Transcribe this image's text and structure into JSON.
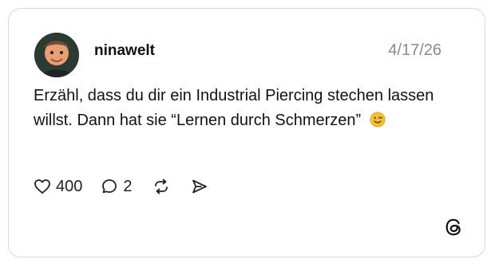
{
  "post": {
    "username": "ninawelt",
    "date": "4/17/26",
    "text": "Erzähl, dass du dir ein Industrial Piercing stechen lassen willst. Dann hat sie “Lernen durch Schmerzen”",
    "emoji_icon": "winking-face-emoji",
    "likes": "400",
    "replies": "2"
  },
  "icons": {
    "like": "heart-icon",
    "reply": "comment-bubble-icon",
    "repost": "repost-icon",
    "share": "send-icon",
    "brand": "threads-logo-icon"
  },
  "colors": {
    "border": "#d9d9d9",
    "date": "#8a8a8a",
    "text": "#121212",
    "emoji": "#f4c12f"
  }
}
